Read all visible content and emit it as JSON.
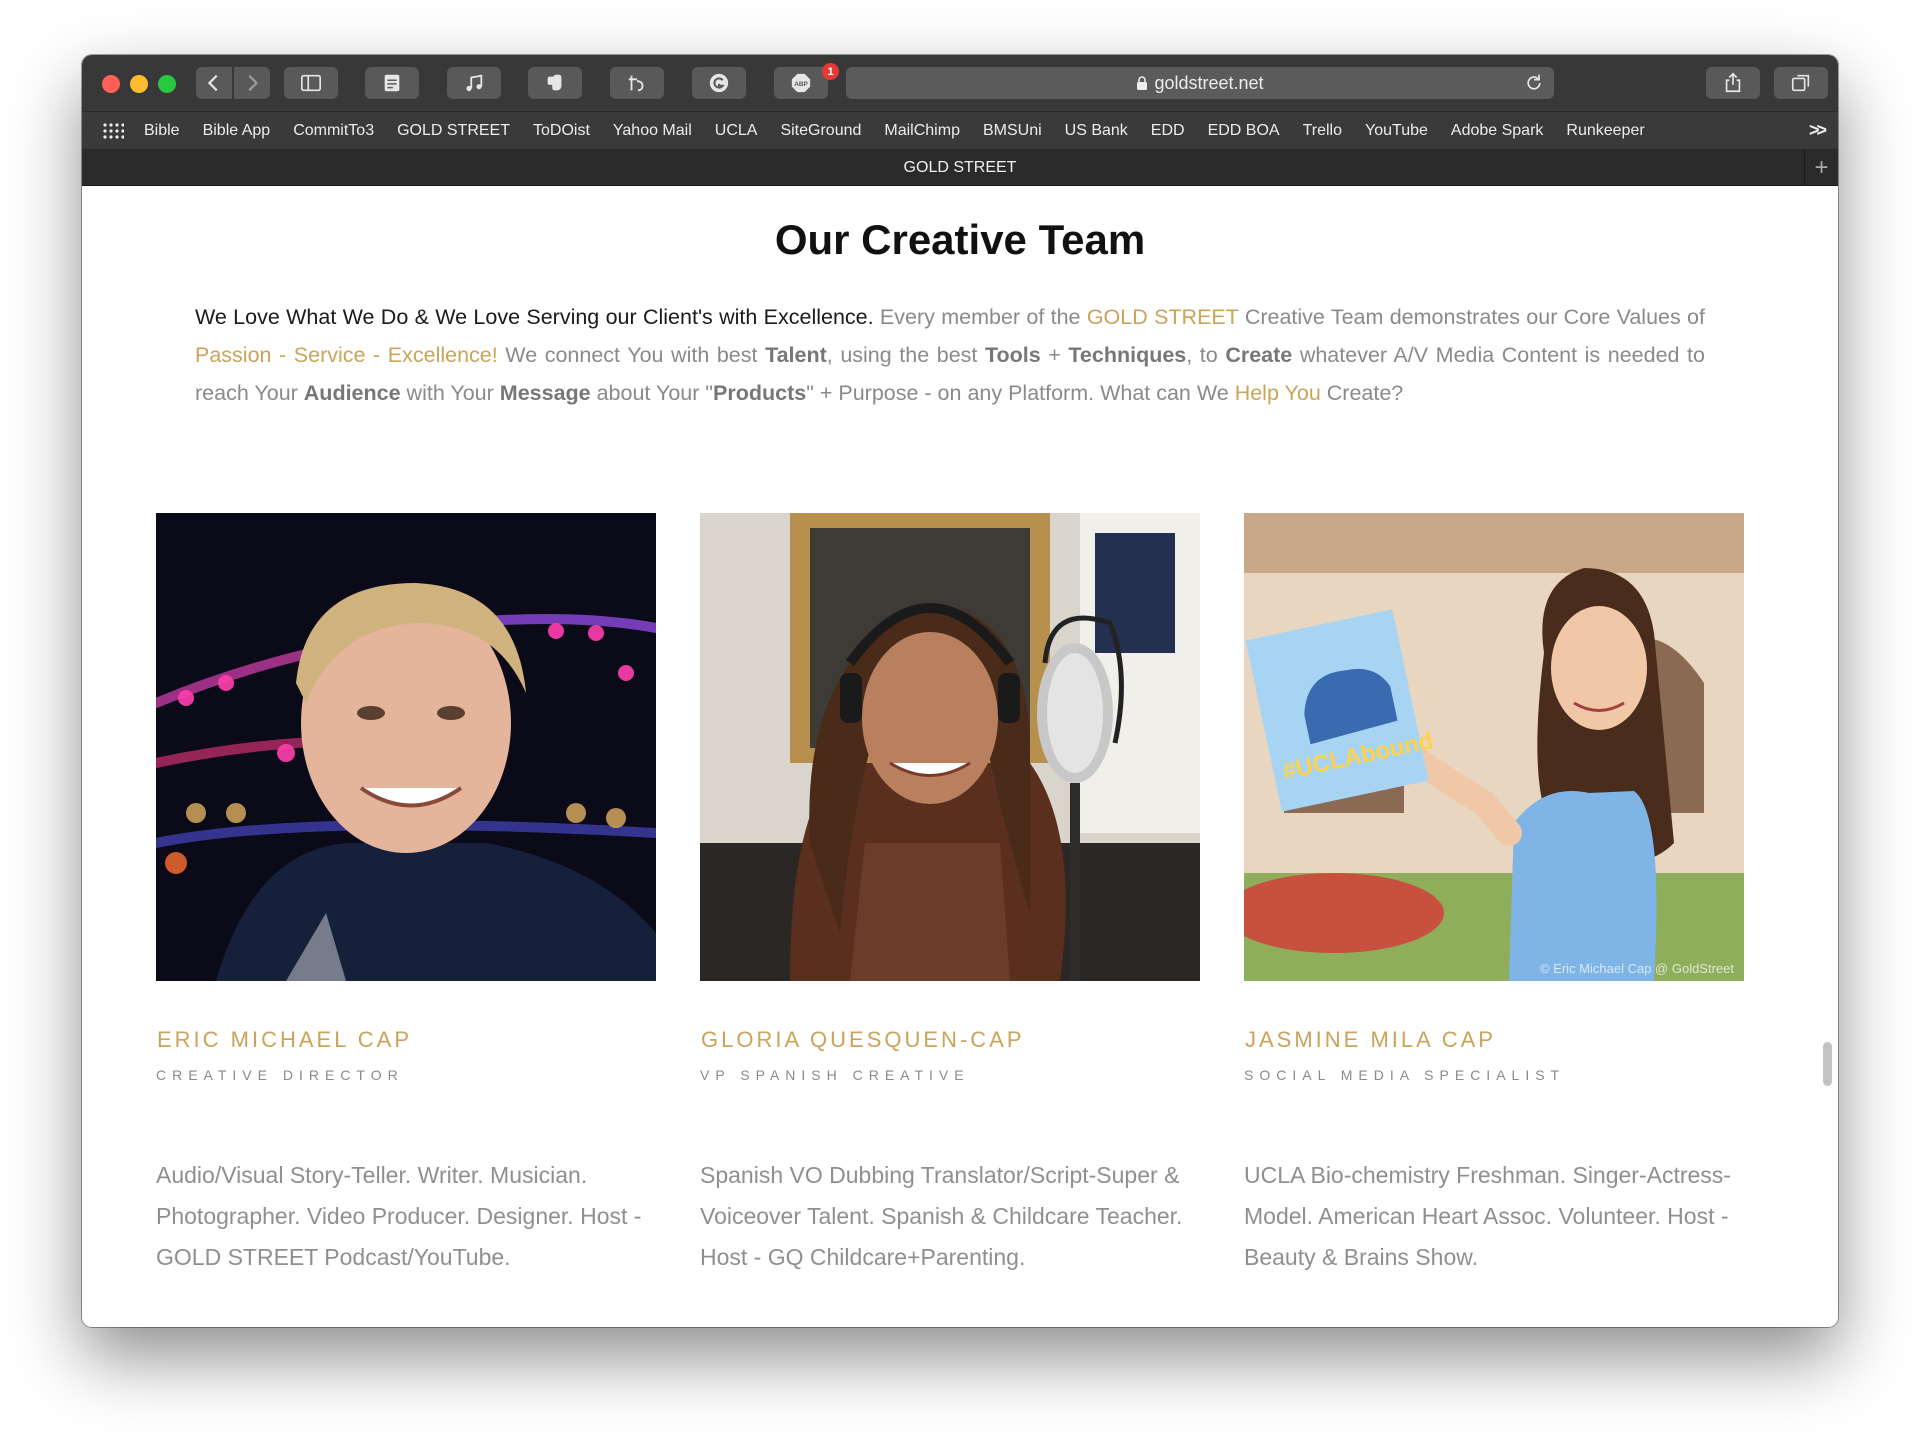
{
  "browser": {
    "url": "goldstreet.net",
    "adblock_badge": "1",
    "tab_title": "GOLD STREET",
    "bookmarks": [
      "Bible",
      "Bible App",
      "CommitTo3",
      "GOLD STREET",
      "ToDOist",
      "Yahoo Mail",
      "UCLA",
      "SiteGround",
      "MailChimp",
      "BMSUni",
      "US Bank",
      "EDD",
      "EDD BOA",
      "Trello",
      "YouTube",
      "Adobe Spark",
      "Runkeeper"
    ],
    "more_bookmarks": ">>",
    "new_tab": "+"
  },
  "page": {
    "title": "Our Creative Team",
    "intro": {
      "lead": "We Love What We Do & We Love Serving our Client's with Excellence.",
      "p1": " Every member of the ",
      "gold_street": "GOLD STREET",
      "p2": " Creative Team demonstrates our Core Values of ",
      "values": "Passion - Service - Excellence!",
      "p3": " We connect You with best ",
      "talent": "Talent",
      "p4": ", using the best ",
      "tools": "Tools",
      "p5": " + ",
      "techniques": "Techniques",
      "p6": ", to ",
      "create": "Create",
      "p7": " whatever A/V Media Content is needed to reach Your ",
      "audience": "Audience",
      "p8": " with Your ",
      "message": "Message",
      "p9": " about Your \"",
      "products": "Products",
      "p10": "\" + Purpose - on any Platform. What can We ",
      "help_you": "Help You",
      "p11": " Create?"
    },
    "team": [
      {
        "name": "ERIC MICHAEL CAP",
        "role": "CREATIVE DIRECTOR",
        "bio": "Audio/Visual Story-Teller. Writer. Musician. Photographer. Video Producer. Designer. Host - GOLD STREET Podcast/YouTube.",
        "socials": [
          "facebook-icon",
          "youtube-icon",
          "linkedin-icon"
        ]
      },
      {
        "name": "GLORIA QUESQUEN-CAP",
        "role": "VP SPANISH CREATIVE",
        "bio": "Spanish VO Dubbing Translator/Script-Super & Voiceover Talent. Spanish & Childcare Teacher. Host - GQ Childcare+Parenting.",
        "socials": [
          "facebook-icon",
          "youtube-icon",
          "pinterest-icon"
        ]
      },
      {
        "name": "JASMINE MILA CAP",
        "role": "SOCIAL MEDIA SPECIALIST",
        "bio": "UCLA Bio-chemistry Freshman. Singer-Actress-Model. American Heart Assoc. Volunteer. Host - Beauty & Brains Show.",
        "socials": [
          "instagram-icon",
          "youtube-icon",
          "pinterest-icon"
        ],
        "sign_text": "#UCLAbound",
        "photo_credit": "© Eric Michael Cap @ GoldStreet"
      }
    ]
  },
  "colors": {
    "accent_gold": "#c9a45a",
    "body_gray": "#8a8a8a",
    "chrome_dark": "#383838"
  }
}
